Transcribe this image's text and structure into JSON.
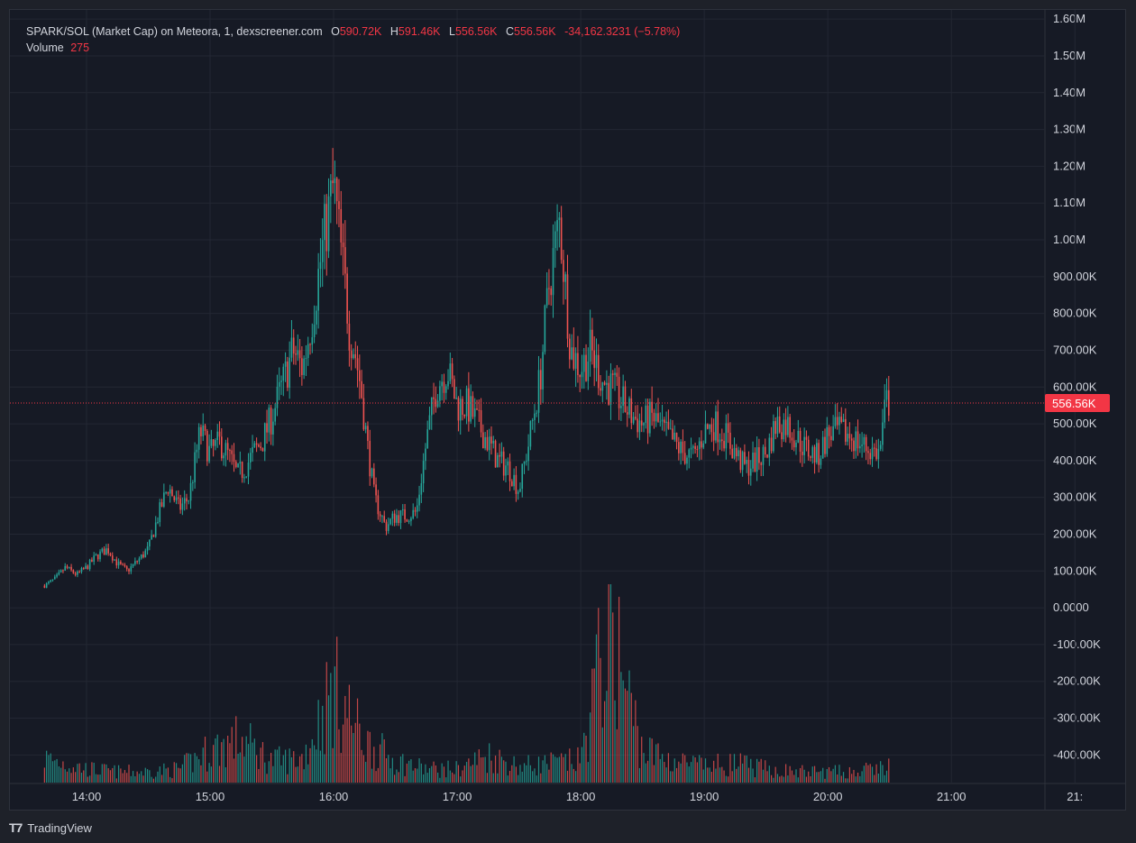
{
  "legend": {
    "symbol": "SPARK/SOL (Market Cap) on Meteora, 1, dexscreener.com",
    "o_label": "O",
    "o_value": "590.72K",
    "h_label": "H",
    "h_value": "591.46K",
    "l_label": "L",
    "l_value": "556.56K",
    "c_label": "C",
    "c_value": "556.56K",
    "change": "-34,162.3231 (−5.78%)",
    "volume_label": "Volume",
    "volume_value": "275"
  },
  "footer": {
    "logo_text": "TradingView"
  },
  "colors": {
    "up": "#26a69a",
    "down": "#ef5350",
    "background": "#161a25",
    "grid": "#232733",
    "axis_text": "#d1d4dc",
    "price_line": "#f23645"
  },
  "chart_data": {
    "type": "candlestick",
    "y_axis": {
      "ticks": [
        1600000,
        1500000,
        1400000,
        1300000,
        1200000,
        1100000,
        1000000,
        900000,
        800000,
        700000,
        600000,
        500000,
        400000,
        300000,
        200000,
        100000,
        0,
        -100000,
        -200000,
        -300000,
        -400000
      ],
      "tick_labels": [
        "1.60M",
        "1.50M",
        "1.40M",
        "1.30M",
        "1.20M",
        "1.10M",
        "1.00M",
        "900.00K",
        "800.00K",
        "700.00K",
        "600.00K",
        "500.00K",
        "400.00K",
        "300.00K",
        "200.00K",
        "100.00K",
        "0.0000",
        "-100.00K",
        "-200.00K",
        "-300.00K",
        "-400.00K"
      ],
      "range": [
        -480000,
        1620000
      ]
    },
    "x_axis": {
      "tick_labels": [
        "14:00",
        "15:00",
        "16:00",
        "17:00",
        "18:00",
        "19:00",
        "20:00",
        "21:00",
        "21:"
      ],
      "tick_hours": [
        14,
        15,
        16,
        17,
        18,
        19,
        20,
        21,
        22
      ],
      "range_hours": [
        13.38,
        21.75
      ]
    },
    "last_price": {
      "value": 556560,
      "label": "556.56K"
    },
    "market_cap_path": {
      "note_free": true,
      "x": [
        13.66,
        13.75,
        13.83,
        13.92,
        14.0,
        14.08,
        14.17,
        14.25,
        14.33,
        14.42,
        14.5,
        14.58,
        14.66,
        14.75,
        14.83,
        14.92,
        15.0,
        15.08,
        15.17,
        15.22,
        15.28,
        15.35,
        15.42,
        15.5,
        15.58,
        15.67,
        15.75,
        15.83,
        15.92,
        16.0,
        16.05,
        16.1,
        16.13,
        16.17,
        16.22,
        16.27,
        16.33,
        16.42,
        16.5,
        16.58,
        16.67,
        16.75,
        16.83,
        16.92,
        17.0,
        17.08,
        17.17,
        17.25,
        17.33,
        17.42,
        17.5,
        17.58,
        17.67,
        17.75,
        17.83,
        17.92,
        18.0,
        18.08,
        18.17,
        18.22,
        18.25,
        18.29,
        18.33,
        18.42,
        18.5,
        18.58,
        18.67,
        18.75,
        18.83,
        18.92,
        19.0,
        19.08,
        19.17,
        19.25,
        19.33,
        19.42,
        19.5,
        19.58,
        19.67,
        19.75,
        19.83,
        19.92,
        20.0,
        20.08,
        20.17,
        20.25,
        20.33,
        20.42,
        20.47,
        20.5
      ],
      "y": [
        60000,
        80000,
        110000,
        90000,
        110000,
        140000,
        160000,
        120000,
        100000,
        130000,
        160000,
        250000,
        330000,
        270000,
        300000,
        480000,
        420000,
        450000,
        400000,
        360000,
        380000,
        420000,
        450000,
        520000,
        600000,
        700000,
        650000,
        800000,
        1000000,
        1150000,
        1000000,
        850000,
        750000,
        700000,
        600000,
        450000,
        300000,
        220000,
        250000,
        250000,
        260000,
        450000,
        600000,
        650000,
        550000,
        550000,
        500000,
        450000,
        400000,
        380000,
        320000,
        450000,
        620000,
        900000,
        1050000,
        700000,
        650000,
        700000,
        620000,
        600000,
        600000,
        580000,
        560000,
        520000,
        500000,
        520000,
        480000,
        450000,
        420000,
        410000,
        480000,
        500000,
        470000,
        420000,
        380000,
        400000,
        420000,
        500000,
        500000,
        460000,
        430000,
        410000,
        470000,
        480000,
        470000,
        450000,
        430000,
        420000,
        560000,
        556560
      ]
    },
    "volume_series": {
      "x": [
        13.66,
        13.75,
        14.0,
        14.25,
        14.5,
        14.75,
        15.0,
        15.25,
        15.5,
        15.75,
        16.0,
        16.25,
        16.5,
        16.75,
        17.0,
        17.25,
        17.5,
        17.75,
        18.0,
        18.25,
        18.33,
        18.5,
        18.75,
        19.0,
        19.25,
        19.5,
        19.75,
        20.0,
        20.25,
        20.5
      ],
      "y": [
        9000,
        8000,
        5000,
        4000,
        4000,
        5000,
        12000,
        16000,
        8000,
        9000,
        35000,
        15000,
        8000,
        5000,
        5000,
        10000,
        6000,
        7000,
        8000,
        65000,
        40000,
        12000,
        8000,
        6000,
        7000,
        5000,
        4000,
        4000,
        4000,
        6000
      ]
    }
  }
}
